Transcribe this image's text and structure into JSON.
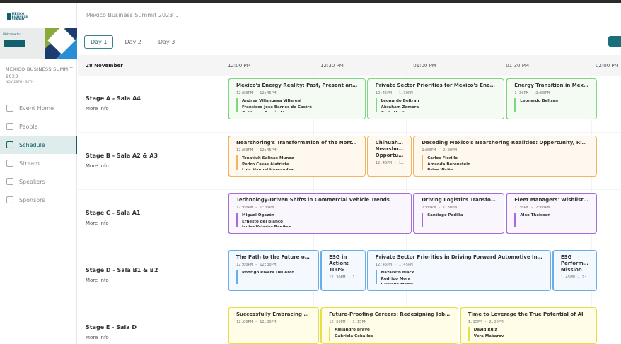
{
  "app": {
    "event_selector": "Mexico Business Summit 2023 ⌄"
  },
  "sidebar": {
    "logo_text": "MEXICO BUSINESS SUMMIT",
    "banner_text": "Welcome to:",
    "event_title": "MEXICO BUSINESS SUMMIT 2023",
    "event_dates": "NOV 28TH - 30TH",
    "items": [
      {
        "label": "Event Home",
        "icon": "home-icon"
      },
      {
        "label": "People",
        "icon": "people-icon"
      },
      {
        "label": "Schedule",
        "icon": "calendar-icon",
        "active": true
      },
      {
        "label": "Stream",
        "icon": "stream-icon"
      },
      {
        "label": "Speakers",
        "icon": "podium-icon"
      },
      {
        "label": "Sponsors",
        "icon": "handshake-icon"
      }
    ]
  },
  "tabs": [
    {
      "label": "Day 1",
      "active": true
    },
    {
      "label": "Day 2"
    },
    {
      "label": "Day 3"
    }
  ],
  "accent": "#12606d",
  "schedule": {
    "date": "28 November",
    "ticks": [
      "12:00 PM",
      "12:30 PM",
      "01:00 PM",
      "01:30 PM",
      "02:00 PM"
    ],
    "stages": [
      {
        "name": "Stage A - Sala A4",
        "more": "More info",
        "color": "#7ed67e",
        "bg": "#f3fbf3",
        "sessions": [
          {
            "title": "Mexico's Energy Reality: Past, Present and Fu...",
            "time": "12:00PM - 12:45PM",
            "start": 0,
            "end": 45,
            "speakers": [
              "Andrea Villanueva Villareal",
              "Francisco Jose Barnes de Castro",
              "Guillermo García Alcocer"
            ]
          },
          {
            "title": "Private Sector Priorities for Mexico's Energy F...",
            "time": "12:45PM - 1:30PM",
            "start": 45,
            "end": 90,
            "speakers": [
              "Leonardo Beltran",
              "Abraham Zamora",
              "Carla Medina"
            ]
          },
          {
            "title": "Energy Transition in Mexico...",
            "time": "1:30PM - 2:00PM",
            "start": 90,
            "end": 120,
            "speakers": [
              "Leonardo Beltran"
            ]
          }
        ]
      },
      {
        "name": "Stage B - Sala A2 & A3",
        "more": "More info",
        "color": "#f2b45e",
        "bg": "#fff8ee",
        "sessions": [
          {
            "title": "Nearshoring's Transformation of the North A...",
            "time": "12:00PM - 12:45PM",
            "start": 0,
            "end": 45,
            "speakers": [
              "Tonatiuh Salinas Munoz",
              "Pedro Casas Alatriste",
              "Luis Manuel Hernandez"
            ]
          },
          {
            "title": "Chihuahua's Nearshoring Opportunity: U...",
            "time": "12:45PM - 1:...",
            "start": 45,
            "end": 60,
            "narrow": true,
            "speakers": []
          },
          {
            "title": "Decoding Mexico's Nearshoring Realities: Opportunity, Risk, Per...",
            "time": "1:00PM - 2:00PM",
            "start": 60,
            "end": 120,
            "speakers": [
              "Carlos Fiorillo",
              "Amanda Berenstein",
              "Brian Waite"
            ]
          }
        ]
      },
      {
        "name": "Stage C - Sala A1",
        "more": "More info",
        "color": "#a46cd6",
        "bg": "#faf6fd",
        "sessions": [
          {
            "title": "Technology-Driven Shifts in Commercial Vehicle Trends",
            "time": "12:00PM - 1:00PM",
            "start": 0,
            "end": 60,
            "speakers": [
              "Miguel Ogazón",
              "Ernesto del Blanco",
              "Javier Valadez Benítez"
            ]
          },
          {
            "title": "Driving Logistics Transform...",
            "time": "1:00PM - 1:30PM",
            "start": 60,
            "end": 90,
            "speakers": [
              "Santiago Padilla"
            ]
          },
          {
            "title": "Fleet Managers' Wishlist: ...",
            "time": "1:30PM - 2:00PM",
            "start": 90,
            "end": 120,
            "speakers": [
              "Alex Theissen"
            ]
          }
        ]
      },
      {
        "name": "Stage D - Sala B1 & B2",
        "more": "More info",
        "color": "#6aaee8",
        "bg": "#f3f9fe",
        "sessions": [
          {
            "title": "The Path to the Future of th...",
            "time": "12:00PM - 12:30PM",
            "start": 0,
            "end": 30,
            "speakers": [
              "Rodrigo Rivera Del Arco"
            ]
          },
          {
            "title": "ESG in Action: 100% Green, 100% Fema...",
            "time": "12:30PM - 12:...",
            "start": 30,
            "end": 45,
            "narrow": true,
            "speakers": []
          },
          {
            "title": "Private Sector Priorities in Driving Forward Automotive Industry...",
            "time": "12:45PM - 1:45PM",
            "start": 45,
            "end": 105,
            "speakers": [
              "Nazareth Black",
              "Rodrigo Mora",
              "Gustavo Medir"
            ]
          },
          {
            "title": "ESG Performance: Mission Driven of Leg...",
            "time": "1:45PM - 2:0...",
            "start": 105,
            "end": 120,
            "narrow": true,
            "speakers": []
          }
        ]
      },
      {
        "name": "Stage E - Sala D",
        "more": "More info",
        "color": "#e6df48",
        "bg": "#fffde8",
        "sessions": [
          {
            "title": "Successfully Embracing Hu...",
            "time": "12:00PM - 12:30PM",
            "start": 0,
            "end": 30,
            "speakers": []
          },
          {
            "title": "Future-Proofing Careers: Redesigning Jobs & ...",
            "time": "12:30PM - 1:15PM",
            "start": 30,
            "end": 75,
            "speakers": [
              "Alejandro Bravo",
              "Gabriela Ceballos"
            ]
          },
          {
            "title": "Time to Leverage the True Potential of AI",
            "time": "1:15PM - 2:00PM",
            "start": 75,
            "end": 120,
            "speakers": [
              "David Ruiz",
              "Vera Makarov"
            ]
          }
        ]
      }
    ]
  }
}
